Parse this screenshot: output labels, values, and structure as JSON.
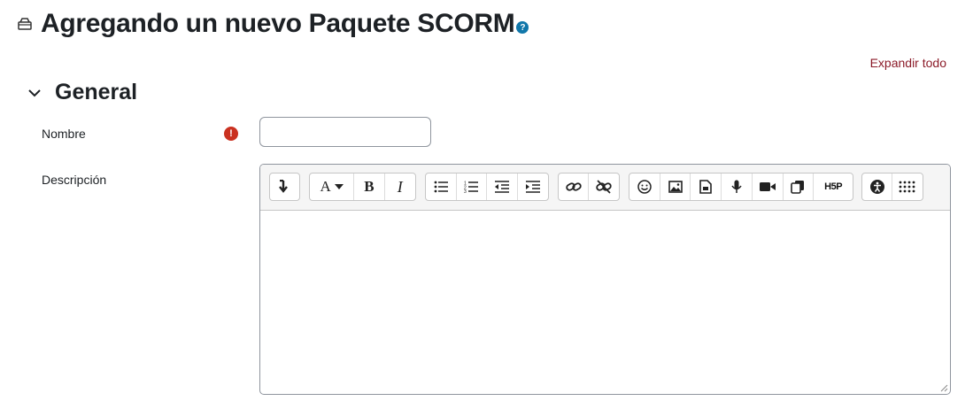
{
  "page": {
    "title": "Agregando un nuevo Paquete SCORM",
    "help_icon": "?",
    "expand_all": "Expandir todo"
  },
  "section": {
    "title": "General"
  },
  "form": {
    "name_label": "Nombre",
    "name_value": "",
    "required_icon": "!",
    "description_label": "Descripción"
  },
  "editor": {
    "toolbar_groups": [
      [
        "collapse-icon"
      ],
      [
        "font-style-icon",
        "bold-icon",
        "italic-icon"
      ],
      [
        "unordered-list-icon",
        "ordered-list-icon",
        "outdent-icon",
        "indent-icon"
      ],
      [
        "link-icon",
        "unlink-icon"
      ],
      [
        "emoji-icon",
        "image-icon",
        "media-file-icon",
        "record-audio-icon",
        "record-video-icon",
        "manage-files-icon",
        "h5p-icon"
      ],
      [
        "accessibility-checker-icon",
        "more-icon"
      ]
    ],
    "bold_label": "B",
    "italic_label": "I",
    "font_label": "A",
    "h5p_label": "H5P"
  }
}
